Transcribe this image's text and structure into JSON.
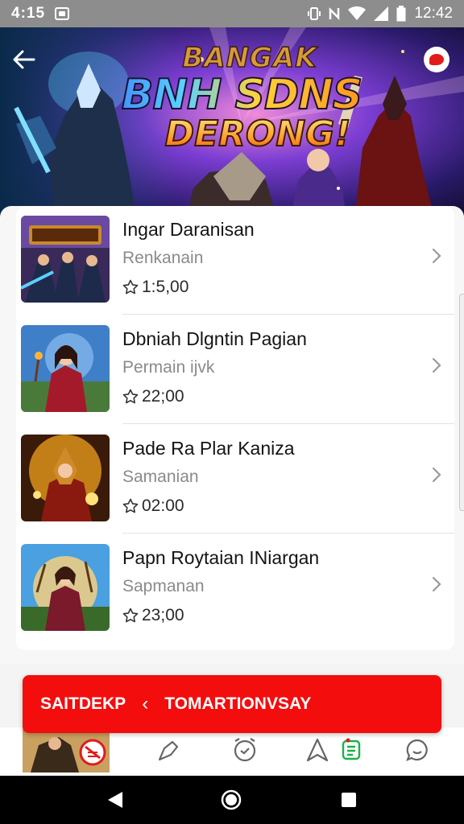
{
  "status_bar": {
    "time_left": "4:15",
    "time_right": "12:42"
  },
  "banner": {
    "title_line1": "BANGAK",
    "title_line2": "BNH SDNS",
    "title_line3": "DERONG!"
  },
  "items": [
    {
      "title": "Ingar Daranisan",
      "subtitle": "Renkanain",
      "price": "1:5,00"
    },
    {
      "title": "Dbniah Dlgntin Pagian",
      "subtitle": "Permain ijvk",
      "price": "22;00"
    },
    {
      "title": "Pade Ra Plar Kaniza",
      "subtitle": "Samanian",
      "price": "02:00"
    },
    {
      "title": "Papn Roytaian INiargan",
      "subtitle": "Sapmanan",
      "price": "23;00"
    }
  ],
  "promo": {
    "left_label": "SAITDEKP",
    "separator": "‹",
    "right_label": "TOMARTIONVSAY"
  },
  "tabs": [
    "close-circle-icon",
    "pin-icon",
    "alarm-icon",
    "navigate-icon",
    "list-icon",
    "chat-icon"
  ],
  "colors": {
    "accent_red": "#f40d0d",
    "active_tab": "#17b34a"
  }
}
